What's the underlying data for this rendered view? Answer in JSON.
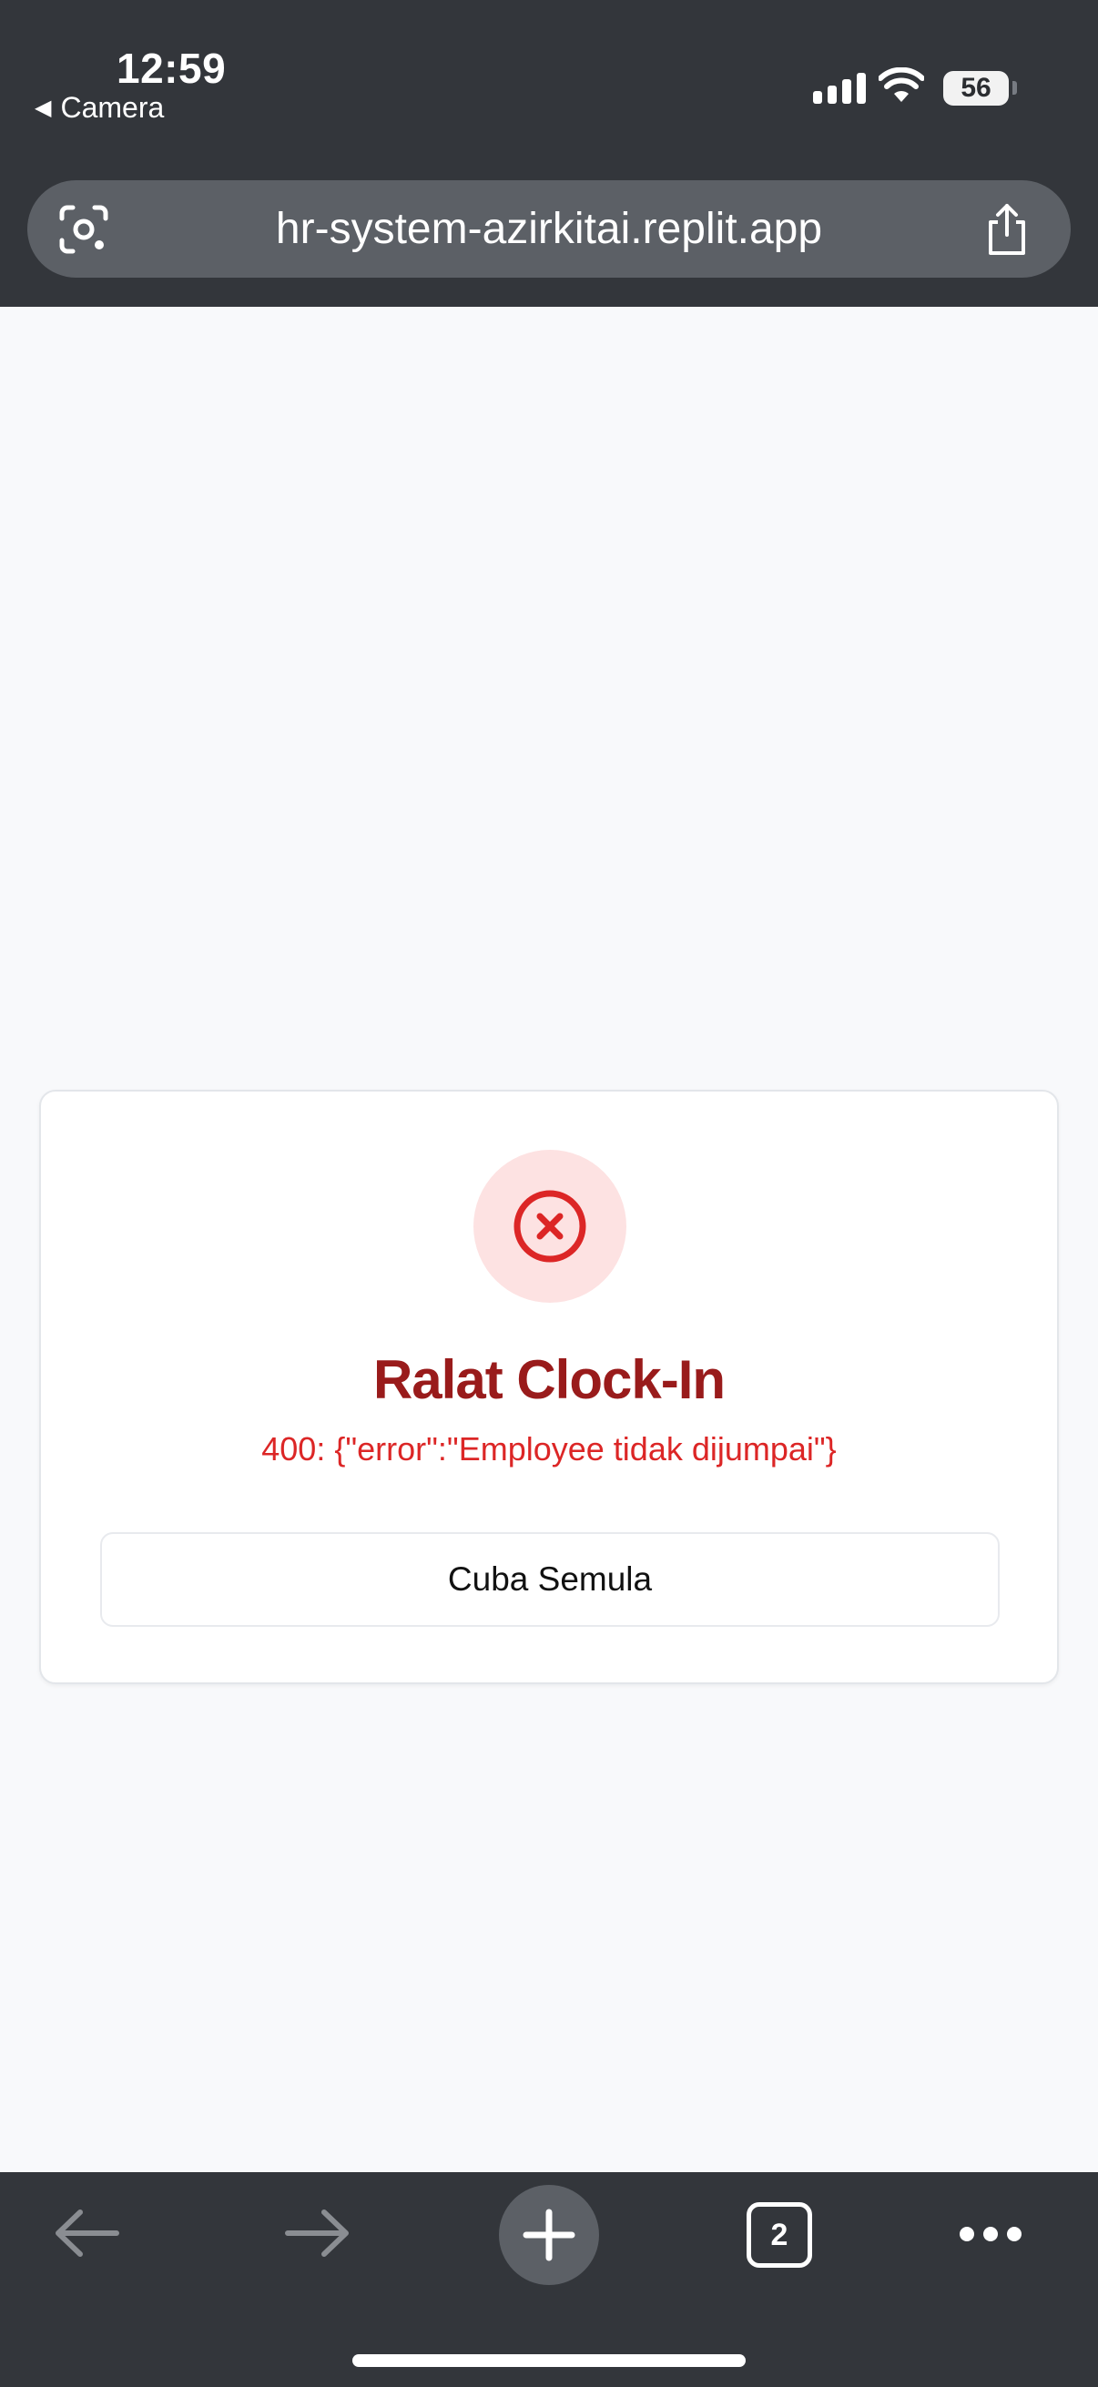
{
  "status_bar": {
    "time": "12:59",
    "back_app_label": "Camera",
    "battery_level": "56"
  },
  "browser": {
    "url": "hr-system-azirkitai.replit.app",
    "tab_count": "2"
  },
  "error_card": {
    "title": "Ralat Clock-In",
    "message": "400: {\"error\":\"Employee tidak dijumpai\"}",
    "retry_label": "Cuba Semula"
  },
  "colors": {
    "chrome": "#33363b",
    "url_bar": "#5c6066",
    "error_title": "#991b1b",
    "error_text": "#dc2626",
    "error_icon_bg": "#fde2e2"
  },
  "icons": {
    "lens": "google-lens-icon",
    "share": "share-icon",
    "error": "x-circle-icon",
    "back": "arrow-left-icon",
    "forward": "arrow-right-icon",
    "new_tab": "plus-icon",
    "menu": "more-horizontal-icon"
  }
}
